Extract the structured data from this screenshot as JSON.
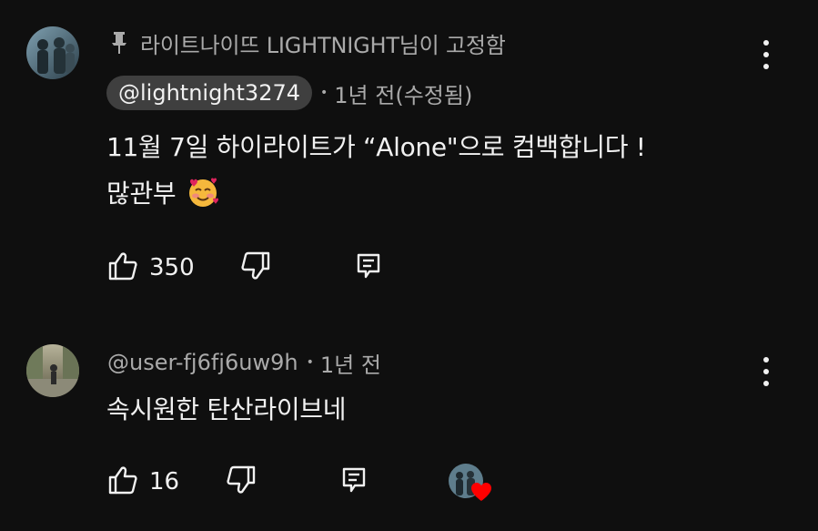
{
  "comments": [
    {
      "pinned_text": "라이트나이뜨 LIGHTNIGHT님이 고정함",
      "author": "@lightnight3274",
      "time": "1년 전(수정됨)",
      "lines": [
        "11월 7일 하이라이트가 “Alone\"으로 컴백합니다 !",
        "많관부"
      ],
      "likes": "350",
      "emoji_icon": "smiling-face-with-hearts-icon"
    },
    {
      "author": "@user-fj6fj6uw9h",
      "time": "1년 전",
      "lines": [
        "속시원한 탄산라이브네"
      ],
      "likes": "16",
      "creator_heart": true
    }
  ],
  "colors": {
    "background": "#0f0f0f",
    "text_primary": "#f1f1f1",
    "text_secondary": "#aaaaaa",
    "author_chip": "#3f3f3f",
    "heart": "#ff0000"
  }
}
